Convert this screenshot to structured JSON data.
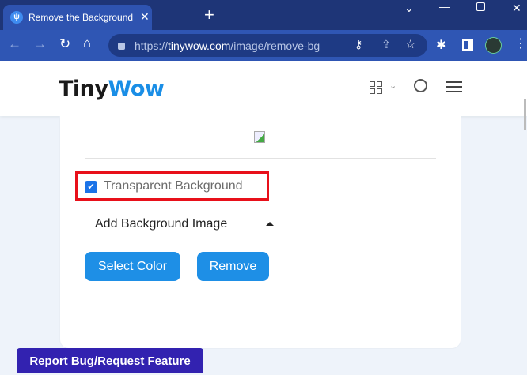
{
  "browser": {
    "tab_title": "Remove the Background From an Image",
    "tab_favicon": "tinywow-icon",
    "new_tab": "+",
    "url_host": "tinywow.com",
    "url_prefix": "https://",
    "url_path": "/image/remove-bg"
  },
  "header": {
    "logo_part1": "Tiny",
    "logo_part2": "Wow"
  },
  "editor": {
    "transparent_label": "Transparent Background",
    "transparent_checked": true,
    "add_bg_label": "Add Background Image",
    "select_color": "Select Color",
    "remove": "Remove"
  },
  "footer": {
    "report": "Report Bug/Request Feature"
  },
  "colors": {
    "accent": "#1e8fe6",
    "report": "#3222b0",
    "highlight": "#e8101a"
  }
}
